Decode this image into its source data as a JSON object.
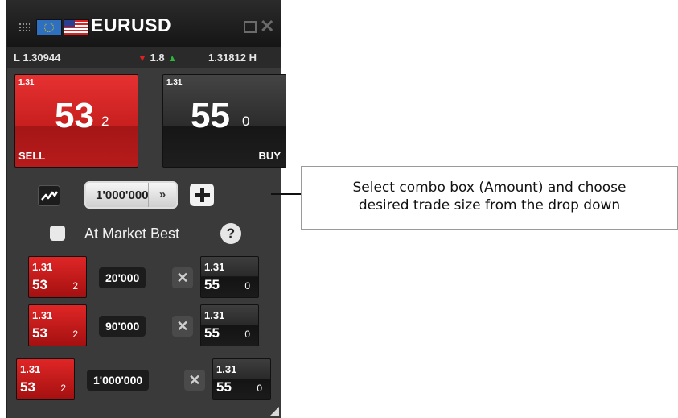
{
  "widget": {
    "title": "EURUSD",
    "low": "L 1.30944",
    "spread": "1.8",
    "high": "1.31812 H",
    "sell": {
      "prefix": "1.31",
      "pips": "53",
      "fraction": "2",
      "label": "SELL"
    },
    "buy": {
      "prefix": "1.31",
      "pips": "55",
      "fraction": "0",
      "label": "BUY"
    },
    "amount": {
      "value": "1'000'000",
      "dropdown_icon": "double-chevron-down-icon"
    },
    "market_best": {
      "label": "At Market Best",
      "checked": false,
      "help": "?"
    },
    "rows": [
      {
        "sell_prefix": "1.31",
        "sell_pips": "53",
        "sell_fraction": "2",
        "amount": "20'000",
        "buy_prefix": "1.31",
        "buy_pips": "55",
        "buy_fraction": "0"
      },
      {
        "sell_prefix": "1.31",
        "sell_pips": "53",
        "sell_fraction": "2",
        "amount": "90'000",
        "buy_prefix": "1.31",
        "buy_pips": "55",
        "buy_fraction": "0"
      },
      {
        "sell_prefix": "1.31",
        "sell_pips": "53",
        "sell_fraction": "2",
        "amount": "1'000'000",
        "buy_prefix": "1.31",
        "buy_pips": "55",
        "buy_fraction": "0"
      }
    ]
  },
  "callout": {
    "line1": "Select combo box (Amount) and choose",
    "line2": "desired trade size from the drop down"
  },
  "colors": {
    "sell": "#d42020",
    "buy": "#222222",
    "panel": "#3a3a3a",
    "spread_down": "#e22020",
    "spread_up": "#29b83a"
  }
}
